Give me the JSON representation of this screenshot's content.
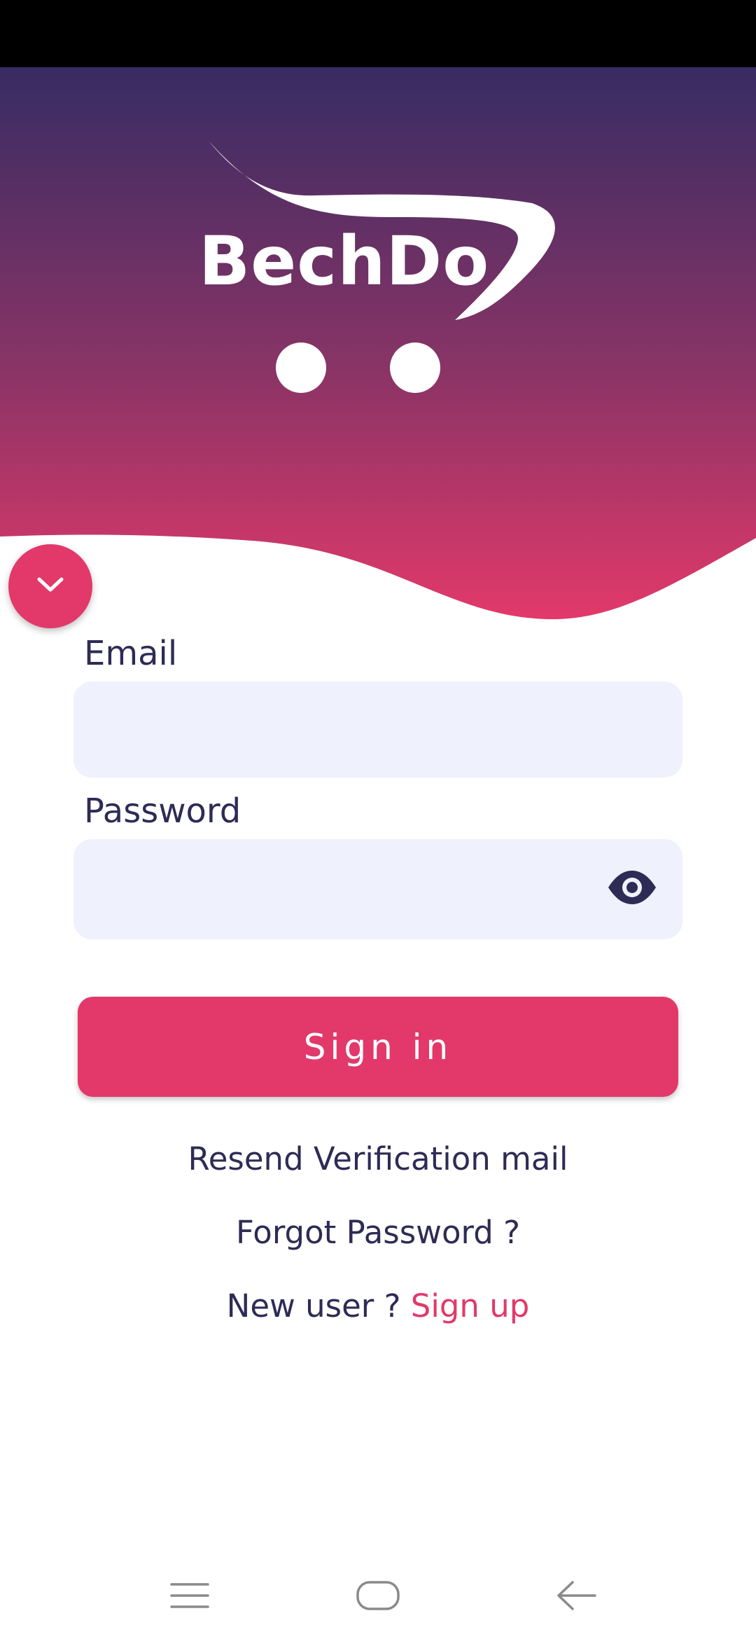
{
  "app": {
    "brand": "BechDo"
  },
  "colors": {
    "primary": "#e2396a",
    "gradient_top": "#372c63",
    "gradient_bottom": "#e2396a",
    "text": "#2e2b55",
    "input_bg": "#eff1fc"
  },
  "icons": {
    "collapse": "chevron-down-icon",
    "visibility": "eye-icon",
    "nav_menu": "menu-icon",
    "nav_home": "home-icon",
    "nav_back": "back-arrow-icon"
  },
  "form": {
    "email_label": "Email",
    "email_value": "",
    "password_label": "Password",
    "password_value": ""
  },
  "actions": {
    "signin_label": "Sign in",
    "resend_label": "Resend Verification mail",
    "forgot_label": "Forgot Password ?",
    "new_user_text": "New user ?",
    "signup_label": "Sign up"
  }
}
